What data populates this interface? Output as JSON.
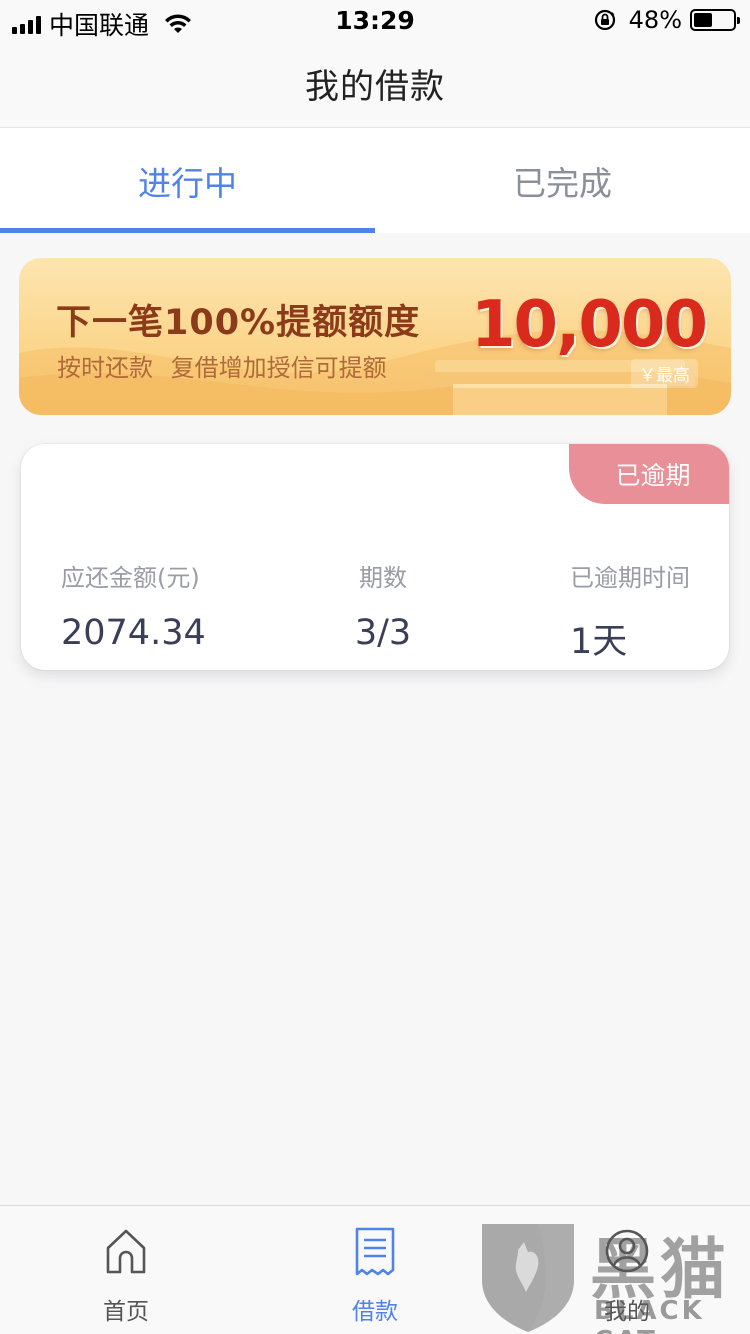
{
  "status_bar": {
    "carrier": "中国联通",
    "time": "13:29",
    "battery_percent": "48%",
    "battery_level": 0.48
  },
  "header": {
    "title": "我的借款"
  },
  "tabs": [
    {
      "label": "进行中",
      "active": true
    },
    {
      "label": "已完成",
      "active": false
    }
  ],
  "banner": {
    "headline": "下一笔100%提额额度",
    "subline": "按时还款 复借增加授信可提额",
    "amount": "10,000",
    "amount_tag": "￥最高"
  },
  "loan_card": {
    "status_badge": "已逾期",
    "amount_label": "应还金额(元)",
    "amount_value": "2074.34",
    "period_label": "期数",
    "period_value": "3/3",
    "overdue_label": "已逾期时间",
    "overdue_value": "1天"
  },
  "tabbar": {
    "items": [
      {
        "label": "首页",
        "icon": "home-icon",
        "active": false
      },
      {
        "label": "借款",
        "icon": "receipt-icon",
        "active": true
      },
      {
        "label": "我的",
        "icon": "user-icon",
        "active": false
      }
    ]
  },
  "watermark": {
    "text_zh": "黑猫",
    "text_en": "BLACK CAT"
  },
  "colors": {
    "accent": "#4f83ea",
    "overdue_badge": "#e88f98",
    "banner_amount": "#d92a1d"
  }
}
